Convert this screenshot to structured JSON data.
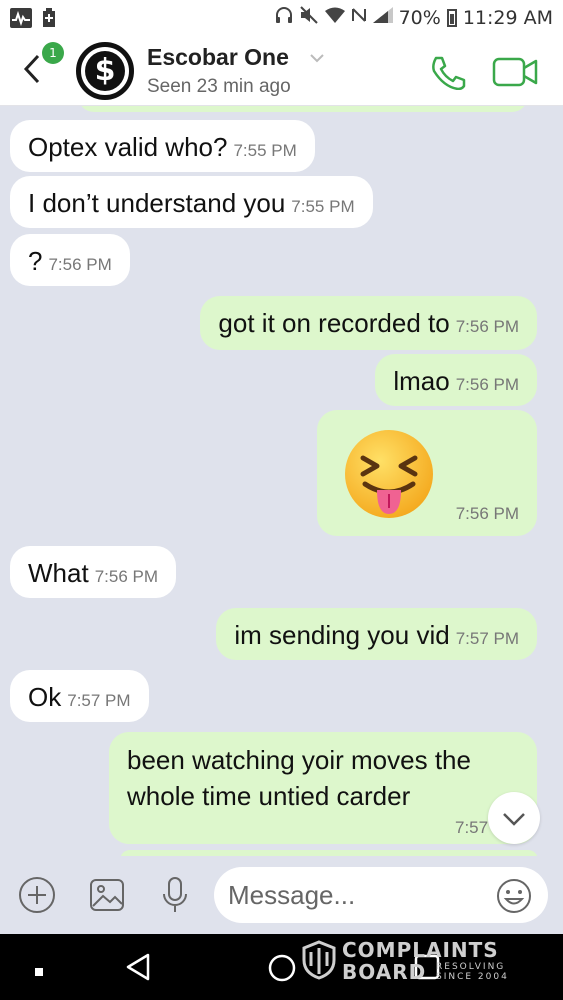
{
  "status_bar": {
    "battery": "70%",
    "time": "11:29 AM"
  },
  "header": {
    "badge_count": "1",
    "contact_name": "Escobar One",
    "seen": "Seen 23 min ago"
  },
  "messages": [
    {
      "dir": "in",
      "text": "Optex valid who?",
      "time": "7:55 PM"
    },
    {
      "dir": "in",
      "text": "I don’t understand you",
      "time": "7:55 PM"
    },
    {
      "dir": "in",
      "text": "?",
      "time": "7:56 PM"
    },
    {
      "dir": "out",
      "text": "got it on recorded to",
      "time": "7:56 PM"
    },
    {
      "dir": "out",
      "text": "lmao",
      "time": "7:56 PM"
    },
    {
      "dir": "out",
      "text": "😝",
      "time": "7:56 PM",
      "kind": "emoji"
    },
    {
      "dir": "in",
      "text": "What",
      "time": "7:56 PM"
    },
    {
      "dir": "out",
      "text": "im sending you vid",
      "time": "7:57 PM"
    },
    {
      "dir": "in",
      "text": "Ok",
      "time": "7:57 PM"
    },
    {
      "dir": "out",
      "line1": "been watching yoir moves the",
      "line2": "whole time untied carder",
      "time": "7:57"
    }
  ],
  "composer": {
    "placeholder": "Message..."
  },
  "watermark": {
    "line1": "COMPLAINTS",
    "line2": "BOARD",
    "small1": "RESOLVING",
    "small2": "SINCE 2004"
  },
  "icons": {
    "status_left": [
      "activity-icon",
      "battery-saver-icon"
    ],
    "status_right": [
      "headphones-icon",
      "mute-icon",
      "wifi-icon",
      "nfc-icon",
      "signal-icon",
      "battery-icon"
    ],
    "composer": [
      "plus-icon",
      "image-icon",
      "microphone-icon",
      "emoji-icon"
    ],
    "nav": [
      "recent-apps-icon",
      "back-icon",
      "home-icon",
      "overview-icon"
    ]
  },
  "colors": {
    "incoming_bubble": "#ffffff",
    "outgoing_bubble": "#ddf7cc",
    "accent_green": "#3aa84a",
    "chat_background": "#dfe2ec"
  }
}
